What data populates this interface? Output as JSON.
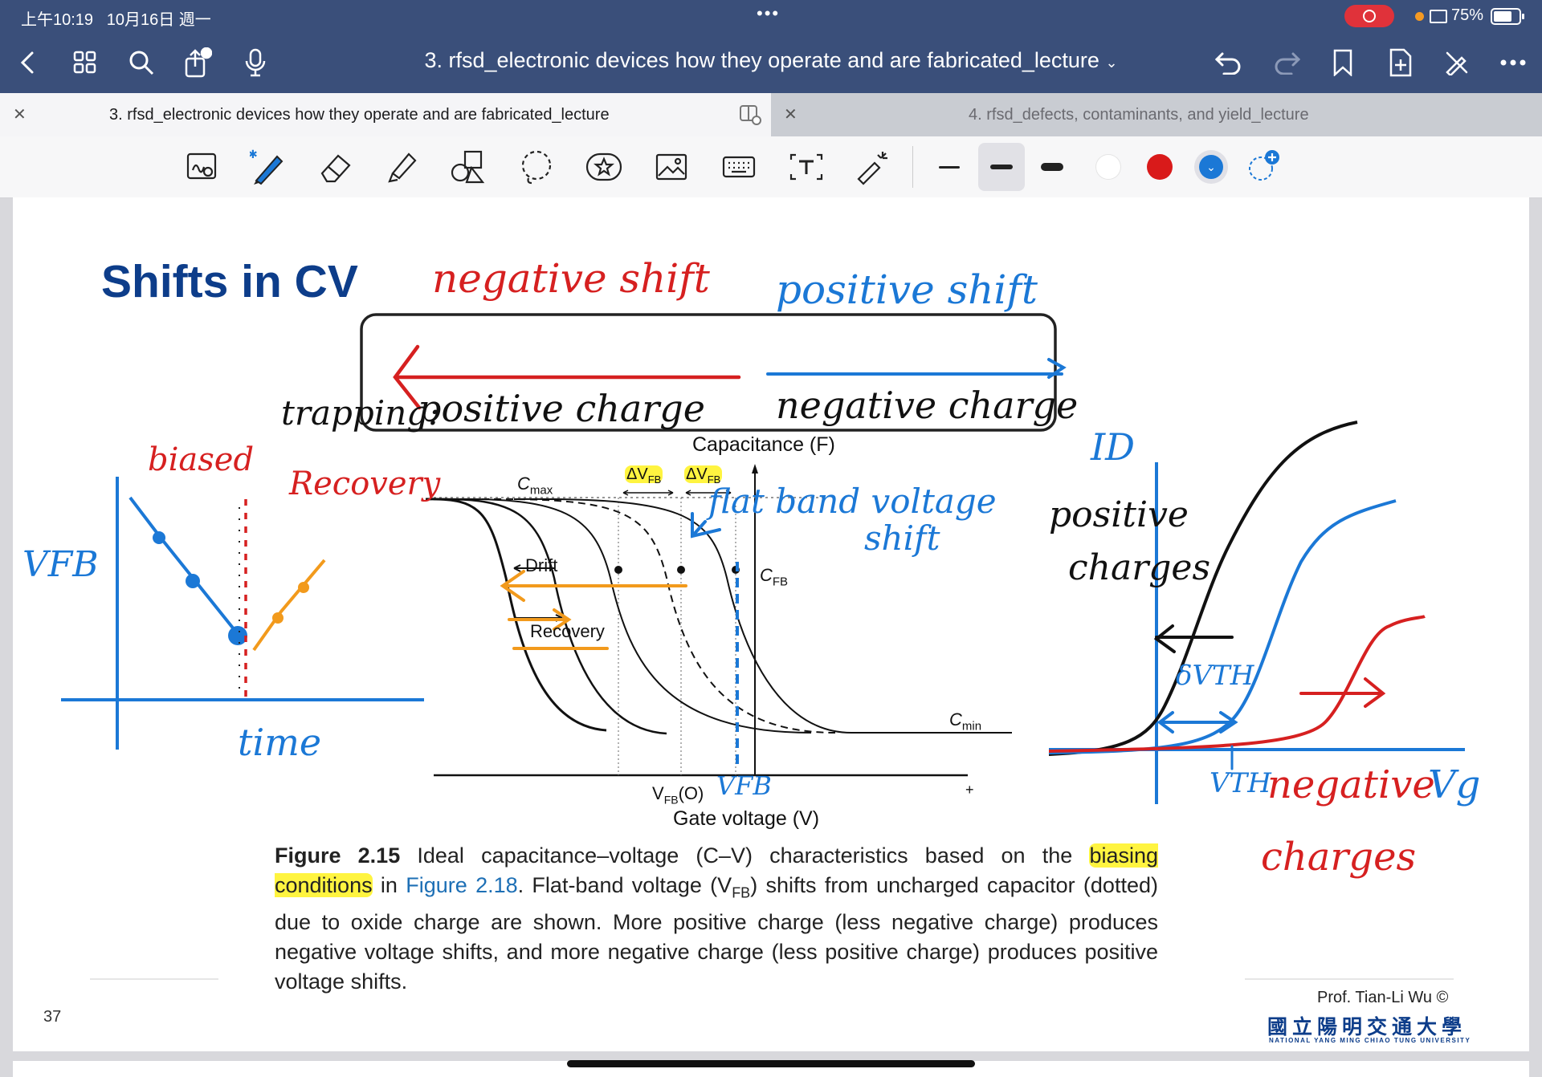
{
  "status": {
    "time": "上午10:19",
    "date": "10月16日 週一",
    "battery": "75%"
  },
  "nav": {
    "title": "3. rfsd_electronic devices how they operate and are fabricated_lecture"
  },
  "tabs": [
    {
      "label": "3. rfsd_electronic devices how they operate and are fabricated_lecture"
    },
    {
      "label": "4. rfsd_defects, contaminants, and yield_lecture"
    }
  ],
  "toolbar": {
    "tools": [
      "lasso-zoom",
      "pen",
      "eraser",
      "highlighter",
      "shapes",
      "lasso",
      "sticker",
      "image",
      "keyboard",
      "text",
      "laser-pointer"
    ],
    "colors": [
      "#ffffff",
      "#d91a1a",
      "#1b78d6"
    ]
  },
  "slide": {
    "title": "Shifts in CV",
    "figure": {
      "y_label": "Capacitance (F)",
      "x_label": "Gate voltage (V)",
      "cmax": "C",
      "cmax_sub": "max",
      "cmin": "C",
      "cmin_sub": "min",
      "cfb": "C",
      "cfb_sub": "FB",
      "dvfb1": "ΔV",
      "dvfb1_sub": "FB",
      "dvfb2": "ΔV",
      "dvfb2_sub": "FB",
      "drift": "Drift",
      "recovery": "Recovery",
      "vfb0": "V",
      "vfb0_sub": "FB",
      "vfb0_tail": "(O)",
      "plus": "+"
    },
    "caption": {
      "fig_num": "Figure 2.15",
      "part1": " Ideal capacitance–voltage (C–V) characteristics based on the ",
      "highlight": "biasing conditions",
      "part2": " in ",
      "link": "Figure 2.18",
      "part3": ". Flat-band voltage (V",
      "sub": "FB",
      "part4": ") shifts from uncharged capacitor (dotted) due to oxide charge are shown. More positive charge (less negative charge) produces negative voltage shifts, and more negative charge (less positive charge) produces positive voltage shifts."
    },
    "page_number": "37",
    "author": "Prof. Tian-Li Wu ©",
    "university_cn": "國立陽明交通大學",
    "university_en": "NATIONAL YANG MING CHIAO TUNG UNIVERSITY"
  },
  "annotations": {
    "negative_shift": "negative shift",
    "positive_shift": "positive shift",
    "trapping": "trapping:",
    "positive_charge": "positive charge",
    "negative_charge": "negative charge",
    "biased": "biased",
    "recovery": "Recovery",
    "vfb": "VFB",
    "time": "time",
    "flat_band_shift_1": "flat band voltage",
    "flat_band_shift_2": "shift",
    "id": "ID",
    "positive_charges_1": "positive",
    "positive_charges_2": "charges",
    "delta_vth": "δVTH",
    "vth": "VTH",
    "negative_charges_1": "negative",
    "negative_charges_2": "charges",
    "vg": "Vg",
    "vfb_hand": "VFB"
  }
}
